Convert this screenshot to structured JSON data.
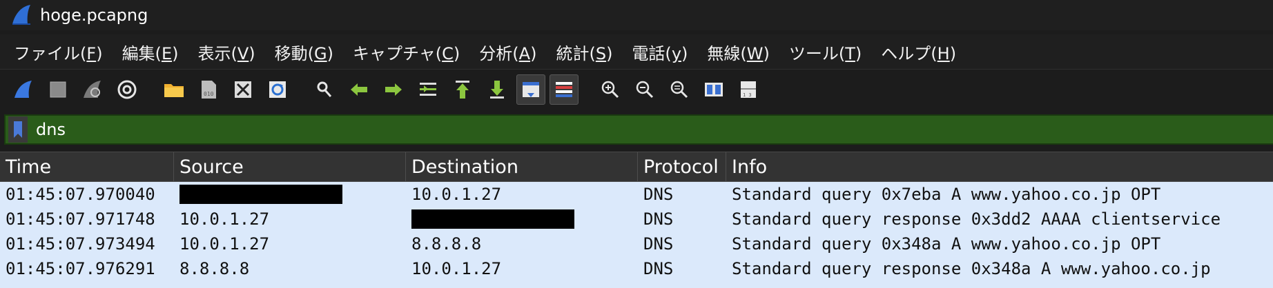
{
  "window": {
    "title": "hoge.pcapng",
    "app_icon": "wireshark-fin-icon"
  },
  "menu": [
    {
      "label": "ファイル(",
      "accel": "F",
      "close": ")"
    },
    {
      "label": "編集(",
      "accel": "E",
      "close": ")"
    },
    {
      "label": "表示(",
      "accel": "V",
      "close": ")"
    },
    {
      "label": "移動(",
      "accel": "G",
      "close": ")"
    },
    {
      "label": "キャプチャ(",
      "accel": "C",
      "close": ")"
    },
    {
      "label": "分析(",
      "accel": "A",
      "close": ")"
    },
    {
      "label": "統計(",
      "accel": "S",
      "close": ")"
    },
    {
      "label": "電話(",
      "accel": "y",
      "close": ")"
    },
    {
      "label": "無線(",
      "accel": "W",
      "close": ")"
    },
    {
      "label": "ツール(",
      "accel": "T",
      "close": ")"
    },
    {
      "label": "ヘルプ(",
      "accel": "H",
      "close": ")"
    }
  ],
  "toolbar_icons": [
    "start-capture-icon",
    "stop-capture-icon",
    "restart-capture-icon",
    "capture-options-icon",
    "open-file-icon",
    "save-file-icon",
    "close-file-icon",
    "reload-file-icon",
    "find-packet-icon",
    "go-back-icon",
    "go-forward-icon",
    "go-to-packet-icon",
    "first-packet-icon",
    "last-packet-icon",
    "autoscroll-icon",
    "colorize-icon",
    "zoom-in-icon",
    "zoom-out-icon",
    "normal-size-icon",
    "resize-columns-icon",
    "layout-icon"
  ],
  "filter": {
    "value": "dns"
  },
  "columns": [
    "Time",
    "Source",
    "Destination",
    "Protocol",
    "Info"
  ],
  "rows": [
    {
      "time": "01:45:07.970040",
      "source": "",
      "source_redacted": true,
      "destination": "10.0.1.27",
      "destination_redacted": false,
      "protocol": "DNS",
      "info": "Standard query 0x7eba A www.yahoo.co.jp OPT"
    },
    {
      "time": "01:45:07.971748",
      "source": "10.0.1.27",
      "source_redacted": false,
      "destination": "",
      "destination_redacted": true,
      "protocol": "DNS",
      "info": "Standard query response 0x3dd2 AAAA clientservice"
    },
    {
      "time": "01:45:07.973494",
      "source": "10.0.1.27",
      "source_redacted": false,
      "destination": "8.8.8.8",
      "destination_redacted": false,
      "protocol": "DNS",
      "info": "Standard query 0x348a A www.yahoo.co.jp OPT"
    },
    {
      "time": "01:45:07.976291",
      "source": "8.8.8.8",
      "source_redacted": false,
      "destination": "10.0.1.27",
      "destination_redacted": false,
      "protocol": "DNS",
      "info": "Standard query response 0x348a A www.yahoo.co.jp"
    }
  ],
  "colors": {
    "filter_valid": "#2a5c1a",
    "row_bg": "#dbe9fb",
    "window_bg": "#1c1c1c"
  }
}
